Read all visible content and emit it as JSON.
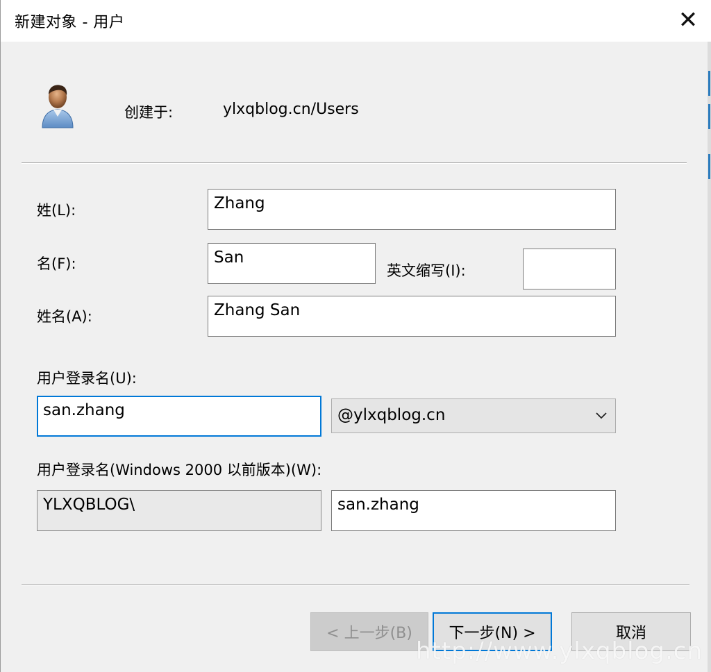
{
  "window": {
    "title": "新建对象 - 用户",
    "close_glyph": "✕"
  },
  "header": {
    "icon": "user-icon",
    "created_in_label": "创建于:",
    "created_in_value": "ylxqblog.cn/Users"
  },
  "form": {
    "last_name": {
      "label": "姓(L):",
      "value": "Zhang"
    },
    "first_name": {
      "label": "名(F):",
      "value": "San"
    },
    "initials": {
      "label": "英文缩写(I):",
      "value": ""
    },
    "full_name": {
      "label": "姓名(A):",
      "value": "Zhang San"
    },
    "logon_name": {
      "label": "用户登录名(U):",
      "value": "san.zhang",
      "suffix": "@ylxqblog.cn"
    },
    "logon_name_pre2000": {
      "label": "用户登录名(Windows 2000 以前版本)(W):",
      "domain": "YLXQBLOG\\",
      "value": "san.zhang"
    }
  },
  "buttons": {
    "back": "< 上一步(B)",
    "next": "下一步(N) >",
    "cancel": "取消"
  },
  "watermark": "http://www.ylxqblog.cn",
  "colors": {
    "focus": "#0078d7",
    "background": "#f0f0f0"
  }
}
